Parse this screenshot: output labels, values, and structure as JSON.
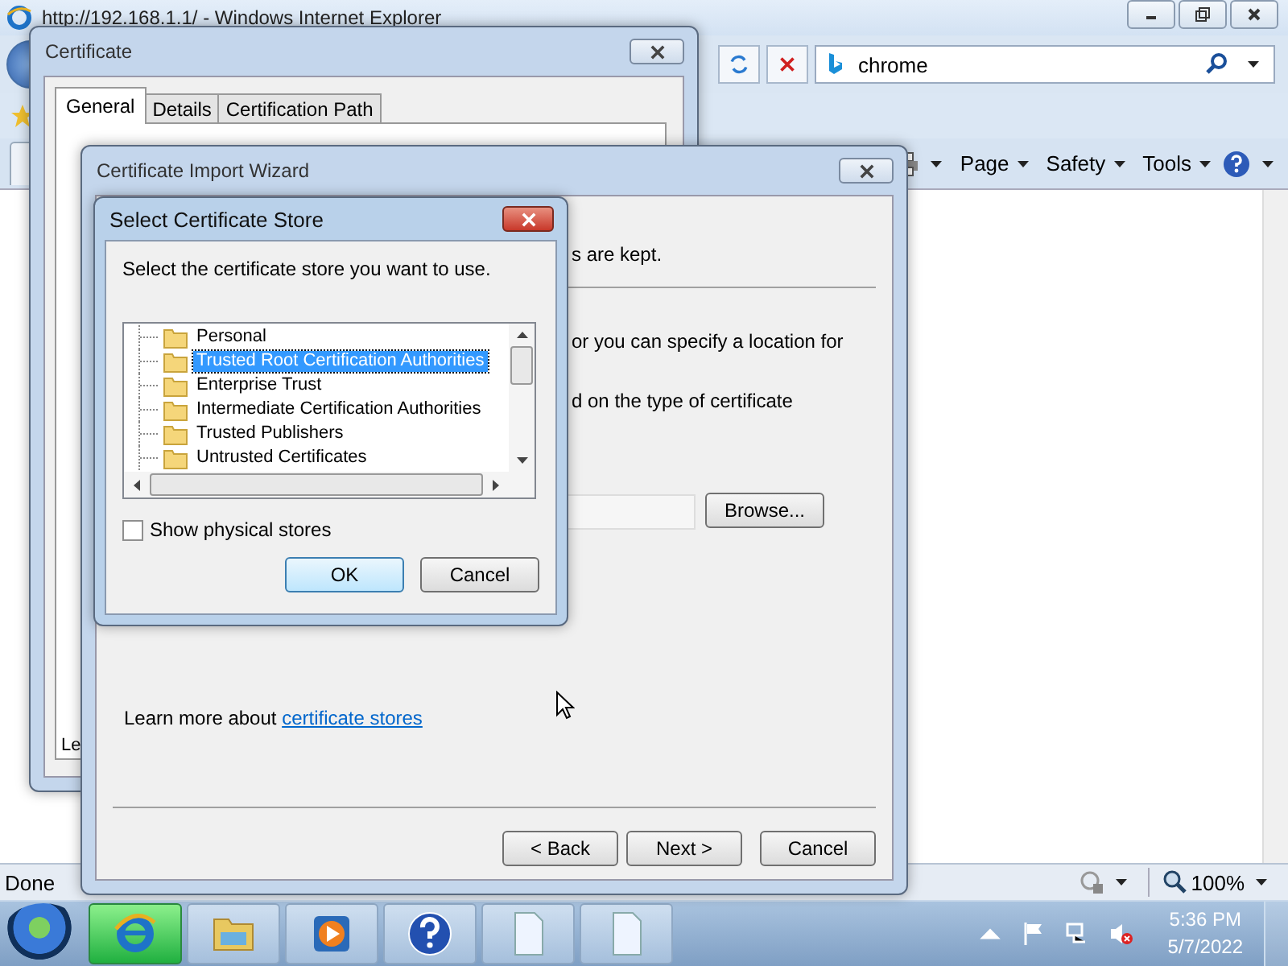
{
  "browser": {
    "title": "http://192.168.1.1/ - Windows Internet Explorer",
    "search": {
      "value": "chrome"
    },
    "commands": [
      {
        "label": "Page"
      },
      {
        "label": "Safety"
      },
      {
        "label": "Tools"
      }
    ],
    "status": "Done",
    "zoom": "100%"
  },
  "certificate_window": {
    "title": "Certificate",
    "tabs": [
      {
        "label": "General",
        "selected": true
      },
      {
        "label": "Details",
        "selected": false
      },
      {
        "label": "Certification Path",
        "selected": false
      }
    ],
    "partial_text": "Le"
  },
  "import_wizard": {
    "title": "Certificate Import Wizard",
    "partial_lines": [
      "s are kept.",
      "or you can specify a location for",
      "d on the type of certificate"
    ],
    "browse": "Browse...",
    "learn_more": {
      "text": "Learn more about",
      "link": "certificate stores"
    },
    "buttons": [
      {
        "label": "< Back",
        "default": false
      },
      {
        "label": "Next >",
        "default": false
      },
      {
        "label": "Cancel",
        "default": false
      }
    ]
  },
  "store_dialog": {
    "title": "Select Certificate Store",
    "instruction": "Select the certificate store you want to use.",
    "stores": [
      {
        "label": "Personal",
        "selected": false
      },
      {
        "label": "Trusted Root Certification Authorities",
        "selected": true
      },
      {
        "label": "Enterprise Trust",
        "selected": false
      },
      {
        "label": "Intermediate Certification Authorities",
        "selected": false
      },
      {
        "label": "Trusted Publishers",
        "selected": false
      },
      {
        "label": "Untrusted Certificates",
        "selected": false
      }
    ],
    "show_physical_stores": {
      "label": "Show physical stores",
      "checked": false
    },
    "buttons": [
      {
        "label": "OK",
        "default": true
      },
      {
        "label": "Cancel",
        "default": false
      }
    ]
  },
  "taskbar": {
    "apps": [
      {
        "kind": "browser",
        "active": true
      },
      {
        "kind": "folder",
        "active": false
      },
      {
        "kind": "media",
        "active": false
      },
      {
        "kind": "help",
        "active": false
      },
      {
        "kind": "document",
        "active": false
      },
      {
        "kind": "document",
        "active": false
      }
    ],
    "time": "5:36 PM",
    "date": "5/7/2022"
  }
}
